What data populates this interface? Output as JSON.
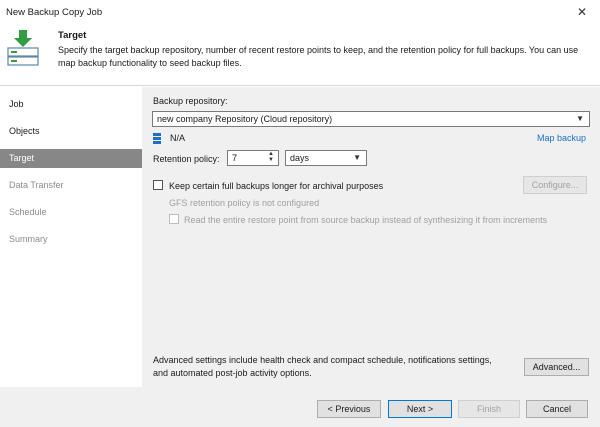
{
  "window": {
    "title": "New Backup Copy Job"
  },
  "header": {
    "title": "Target",
    "description": "Specify the target backup repository, number of recent restore points to keep, and the retention policy for full backups. You can use map backup functionality to seed backup files.",
    "icon": "backup-target-icon"
  },
  "sidebar": {
    "items": [
      {
        "label": "Job",
        "state": "normal"
      },
      {
        "label": "Objects",
        "state": "normal"
      },
      {
        "label": "Target",
        "state": "active"
      },
      {
        "label": "Data Transfer",
        "state": "dim"
      },
      {
        "label": "Schedule",
        "state": "dim"
      },
      {
        "label": "Summary",
        "state": "dim"
      }
    ]
  },
  "main": {
    "repository_label": "Backup repository:",
    "repository_value": "new company Repository (Cloud repository)",
    "repository_space": "N/A",
    "map_backup_link": "Map backup",
    "retention_label": "Retention policy:",
    "retention_value": "7",
    "retention_unit": "days",
    "archival_checkbox_label": "Keep certain full backups longer for archival purposes",
    "configure_button": "Configure...",
    "gfs_status": "GFS retention policy is not configured",
    "read_entire_label": "Read the entire restore point from source backup instead of synthesizing it from increments",
    "advanced_text_line1": "Advanced settings include health check and compact schedule, notifications settings,",
    "advanced_text_line2": "and automated post-job activity options.",
    "advanced_button": "Advanced..."
  },
  "footer": {
    "previous": "< Previous",
    "next": "Next >",
    "finish": "Finish",
    "cancel": "Cancel"
  },
  "colors": {
    "active_nav": "#878787",
    "link": "#1a6fc9",
    "accent_icon": "#2e9e3f",
    "panel_bg": "#f0f0f0"
  }
}
